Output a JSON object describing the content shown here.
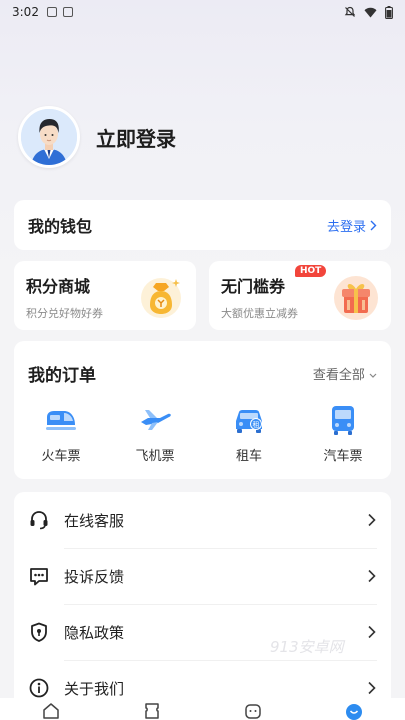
{
  "status_bar": {
    "time": "3:02",
    "icons": [
      "image-icon",
      "a-app-icon",
      "mute-bell-icon",
      "wifi-icon",
      "battery-icon"
    ]
  },
  "profile": {
    "login_label": "立即登录",
    "avatar_icon": "user-avatar-icon"
  },
  "wallet": {
    "title": "我的钱包",
    "link_label": "去登录",
    "link_color": "#2d6ff0"
  },
  "promos": [
    {
      "title": "积分商城",
      "subtitle": "积分兑好物好券",
      "icon": "money-bag-icon"
    },
    {
      "title": "无门槛券",
      "subtitle": "大额优惠立减券",
      "badge": "HOT",
      "icon": "gift-box-icon"
    }
  ],
  "orders": {
    "title": "我的订单",
    "view_all": "查看全部",
    "items": [
      {
        "label": "火车票",
        "icon": "train-icon"
      },
      {
        "label": "飞机票",
        "icon": "plane-icon"
      },
      {
        "label": "租车",
        "icon": "car-rental-icon"
      },
      {
        "label": "汽车票",
        "icon": "bus-icon"
      }
    ]
  },
  "menu": [
    {
      "label": "在线客服",
      "icon": "headset-icon"
    },
    {
      "label": "投诉反馈",
      "icon": "chat-icon"
    },
    {
      "label": "隐私政策",
      "icon": "shield-icon"
    },
    {
      "label": "关于我们",
      "icon": "info-icon"
    }
  ],
  "watermark": "913安卓网",
  "tabbar": [
    "home-icon",
    "ticket-icon",
    "service-icon",
    "profile-icon"
  ],
  "colors": {
    "accent": "#2d6ff0",
    "icon_blue": "#3a8ef6",
    "hot": "#f2453b"
  }
}
